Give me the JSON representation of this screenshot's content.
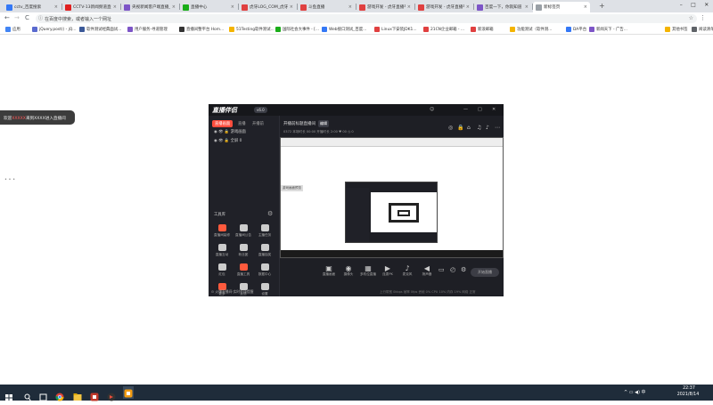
{
  "browser": {
    "tabs": [
      {
        "label": "cctv_百度搜索",
        "color": "#3478f6"
      },
      {
        "label": "CCTV-13新闻频道直播",
        "color": "#e02020"
      },
      {
        "label": "央视新闻客户端直播_央视",
        "color": "#7d55c7"
      },
      {
        "label": "直播中心",
        "color": "#1aad19"
      },
      {
        "label": "虎牙LOG_COM_虎牙直播",
        "color": "#e04040"
      },
      {
        "label": "斗鱼直播",
        "color": "#e04040"
      },
      {
        "label": "游戏开发 - 虎牙直播平台",
        "color": "#e04040"
      },
      {
        "label": "游戏开发 - 虎牙直播平台",
        "color": "#e04040"
      },
      {
        "label": "百度一下，你就知道",
        "color": "#7d55c7"
      },
      {
        "label": "新标签页",
        "color": "#9aa0a6"
      }
    ],
    "new_tab": "+",
    "window_min": "–",
    "window_max": "□",
    "window_close": "✕",
    "nav": {
      "back": "←",
      "forward": "→",
      "reload": "C"
    },
    "omnibox_text": "在百度中搜索，或者输入一个网址",
    "star": "☆",
    "profile": "●",
    "menu": "⋮",
    "bookmarks": [
      {
        "label": "应用",
        "color": "#4285f4"
      },
      {
        "label": "jQuery.post() - jQ...",
        "color": "#5a6acf"
      },
      {
        "label": "软件测试经典面试...",
        "color": "#3b5998"
      },
      {
        "label": "用户服务-寻道管理",
        "color": "#7d55c7"
      },
      {
        "label": "直播间整平台 Hom...",
        "color": "#333333"
      },
      {
        "label": "51Testing软件测试...",
        "color": "#f4b400"
      },
      {
        "label": "国际社会大事件 - [...",
        "color": "#1aad19"
      },
      {
        "label": "Web接口测试_百度...",
        "color": "#3478f6"
      },
      {
        "label": "Linux下安装JDK1...",
        "color": "#e04040"
      },
      {
        "label": "21CN企业邮箱 - ...",
        "color": "#e04040"
      },
      {
        "label": "新浪邮箱",
        "color": "#e04040"
      },
      {
        "label": "功能测试（软件测...",
        "color": "#f4b400"
      },
      {
        "label": "DA平台",
        "color": "#3478f6"
      },
      {
        "label": "新闻天下 - 广告...",
        "color": "#7d55c7"
      },
      {
        "label": "其他书签",
        "color": "#f4b400"
      },
      {
        "label": "阅读清单",
        "color": "#5f6368"
      }
    ]
  },
  "page": {
    "notice_prefix": "欢迎",
    "notice_highlight": "XXXXX",
    "notice_suffix": "来到XXXX进入直播间",
    "side_dots": "• • •"
  },
  "app": {
    "logo": "直播伴侣",
    "version": "v6.0",
    "window_icons": [
      "☺",
      "—",
      "□",
      "✕"
    ],
    "left_tabs": [
      "直播画面",
      "直播",
      "开播前"
    ],
    "sources": [
      "◉ 👁 🔒 游戏画面",
      "◉ 👁 🔒 全屏 0"
    ],
    "tools_label": "工具库",
    "tools_settings": "⚙",
    "tools": [
      {
        "label": "直播间装修",
        "color": "#ff5a3d"
      },
      {
        "label": "直播间公告",
        "color": "#cccccc"
      },
      {
        "label": "主播任务",
        "color": "#cccccc"
      },
      {
        "label": "直播互动",
        "color": "#cccccc"
      },
      {
        "label": "粉丝团",
        "color": "#cccccc"
      },
      {
        "label": "直播抽奖",
        "color": "#cccccc"
      },
      {
        "label": "红包",
        "color": "#cccccc"
      },
      {
        "label": "直播工具",
        "color": "#ff5a3d"
      },
      {
        "label": "数据中心",
        "color": "#cccccc"
      },
      {
        "label": "更多",
        "color": "#ff5a3d"
      },
      {
        "label": "反馈",
        "color": "#cccccc"
      },
      {
        "label": "设置",
        "color": "#cccccc"
      }
    ],
    "bottom_hint": "⊙ 火爆直播间·实时在线提醒",
    "room_title": "开播前标题直播间",
    "room_badge": "编辑",
    "room_info": "0372  本场时长 00:00  开播时长 2:00  ♥ 00  ◷ 0",
    "top_icons": [
      "◎",
      "🔒",
      "⌂",
      "♫",
      "♪",
      "⋯"
    ],
    "preview_tag": "游戏画面预览",
    "controls": [
      {
        "label": "直播画面",
        "icon": "▣"
      },
      {
        "label": "摄像头",
        "icon": "◉"
      },
      {
        "label": "多机位直播",
        "icon": "▦"
      },
      {
        "label": "连麦PK",
        "icon": "▶"
      },
      {
        "label": "麦克风",
        "icon": "♪"
      },
      {
        "label": "扬声器",
        "icon": "◀"
      }
    ],
    "extra_icons": [
      "▭",
      "◴",
      "⚙"
    ],
    "start_label": "开始直播",
    "status_line": "上行带宽 0kbps  帧率 0fps  丢帧 0%  CPU 10%  内存 19%  网络 正常"
  },
  "taskbar": {
    "time": "22:37",
    "date": "2021/8/14"
  }
}
